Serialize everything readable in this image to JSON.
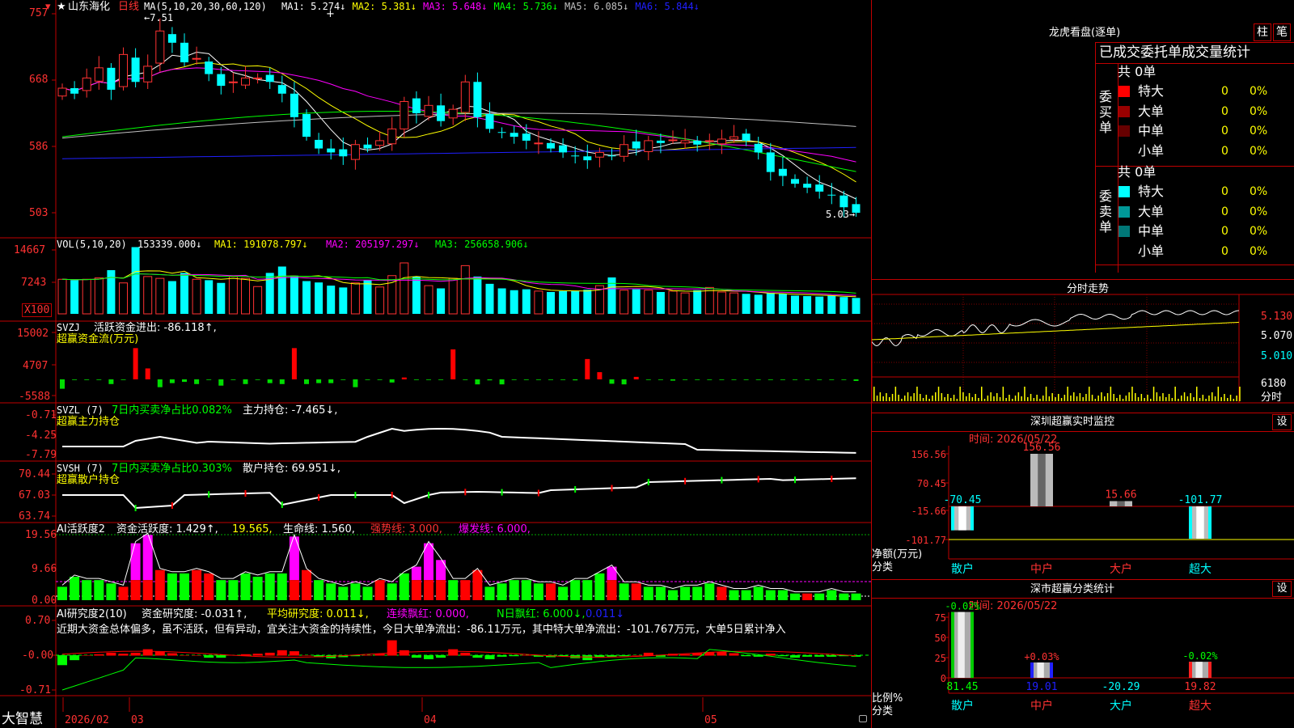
{
  "stock": {
    "star": "★",
    "name": "山东海化",
    "period": "日线"
  },
  "main_chart": {
    "y_ticks": [
      "757",
      "668",
      "586",
      "503"
    ],
    "ma_label": "MA(5,10,20,30,60,120)",
    "ma": [
      {
        "label": "MA1: 5.274↓",
        "color": "#ffffff"
      },
      {
        "label": "MA2: 5.381↓",
        "color": "#ffff00"
      },
      {
        "label": "MA3: 5.648↓",
        "color": "#ff00ff"
      },
      {
        "label": "MA4: 5.736↓",
        "color": "#00ff00"
      },
      {
        "label": "MA5: 6.085↓",
        "color": "#c0c0c0"
      },
      {
        "label": "MA6: 5.844↓",
        "color": "#2020ff"
      }
    ],
    "high_marker": "←7.51",
    "low_marker": "5.03→",
    "cursor_mark": "+"
  },
  "vol": {
    "label": "VOL(5,10,20)",
    "value": "153339.000↓",
    "ma1": "MA1: 191078.797↓",
    "ma2": "MA2: 205197.297↓",
    "ma3": "MA3: 256658.906↓",
    "y_ticks": [
      "14667",
      "7243"
    ],
    "unit": "X100"
  },
  "svzj": {
    "label": "SVZJ",
    "title": "活跃资金进出: -86.118↑,",
    "subtitle": "超赢资金流(万元)",
    "y_ticks": [
      "15002",
      "4707",
      "-5588"
    ]
  },
  "svzl": {
    "label": "SVZL (7)",
    "part1": "7日内买卖净占比0.082%",
    "part2": "主力持仓: -7.465↓,",
    "subtitle": "超赢主力持仓",
    "y_ticks": [
      "-0.71",
      "-4.25",
      "-7.79"
    ]
  },
  "svsh": {
    "label": "SVSH (7)",
    "part1": "7日内买卖净占比0.303%",
    "part2": "散户持仓: 69.951↓,",
    "subtitle": "超赢散户持仓",
    "y_ticks": [
      "70.44",
      "67.03",
      "63.74"
    ]
  },
  "ai_active": {
    "label": "AI活跃度2",
    "t1": "资金活跃度: 1.429↑,",
    "t2": "19.565,",
    "t3": "生命线: 1.560,",
    "t4": "强势线: 3.000,",
    "t5": "爆发线: 6.000,",
    "y_ticks": [
      "19.56",
      "9.66",
      "0.00"
    ]
  },
  "ai_research": {
    "label": "AI研究度2(10)",
    "t1": "资金研究度: -0.031↑,",
    "t2": "平均研究度: 0.011↓,",
    "t3": "连续飘红: 0.000,",
    "t4": "N日飘红: 6.000↓,",
    "t5": "0.011↓",
    "commentary": "近期大资金总体偏多，虽不活跃，但有异动，宜关注大资金的持续性，今日大单净流出：-86.11万元，其中特大单净流出：-101.767万元，大单5日累计净入",
    "y_ticks": [
      "0.70",
      "-0.00",
      "-0.71"
    ]
  },
  "time_axis": {
    "brand": "大智慧",
    "labels": [
      "2026/02",
      "03",
      "04",
      "05"
    ]
  },
  "dragon_tiger": {
    "title": "龙虎看盘(逐单)",
    "btn_bar": "柱",
    "btn_pen": "笔",
    "tabs": [
      "已成交",
      "委托单",
      "成交量",
      "统计"
    ],
    "buy": {
      "side": "委买单",
      "total": "共 0单",
      "rows": [
        {
          "name": "特大",
          "count": "0",
          "pct": "0%",
          "color": "#ff0000"
        },
        {
          "name": "大单",
          "count": "0",
          "pct": "0%",
          "color": "#990000"
        },
        {
          "name": "中单",
          "count": "0",
          "pct": "0%",
          "color": "#660000"
        },
        {
          "name": "小单",
          "count": "0",
          "pct": "0%",
          "color": ""
        }
      ]
    },
    "sell": {
      "side": "委卖单",
      "total": "共 0单",
      "rows": [
        {
          "name": "特大",
          "count": "0",
          "pct": "0%",
          "color": "#00ffff"
        },
        {
          "name": "大单",
          "count": "0",
          "pct": "0%",
          "color": "#009999"
        },
        {
          "name": "中单",
          "count": "0",
          "pct": "0%",
          "color": "#007777"
        },
        {
          "name": "小单",
          "count": "0",
          "pct": "0%",
          "color": ""
        }
      ]
    }
  },
  "intraday": {
    "title": "分时走势",
    "prices": [
      "5.130",
      "5.070",
      "5.010"
    ],
    "volume": "6180",
    "volume_label": "分时"
  },
  "sz_monitor": {
    "title": "深圳超赢实时监控",
    "btn": "设",
    "time": "时间: 2026/05/22",
    "y_ticks": [
      "156.56",
      "70.45",
      "-15.66",
      "-101.77"
    ],
    "y_label": "净额(万元)",
    "x_label": "分类",
    "categories": [
      "散户",
      "中户",
      "大户",
      "超大"
    ],
    "values": [
      -70.45,
      156.56,
      15.66,
      -101.77
    ],
    "value_labels": [
      "-70.45",
      "156.56",
      "15.66",
      "-101.77"
    ]
  },
  "sz_class": {
    "title": "深市超赢分类统计",
    "btn": "设",
    "time": "时间: 2026/05/22",
    "y_ticks": [
      "75",
      "50",
      "25",
      "0"
    ],
    "y_label": "比例%",
    "x_label": "分类",
    "categories": [
      "散户",
      "中户",
      "大户",
      "超大"
    ],
    "percent": [
      81.45,
      19.01,
      -20.29,
      19.82
    ],
    "bottom_labels": [
      "81.45",
      "19.01",
      "-20.29",
      "19.82"
    ],
    "top_labels": [
      "-0.02%",
      "+0.03%",
      "",
      "-0.02%"
    ]
  }
}
